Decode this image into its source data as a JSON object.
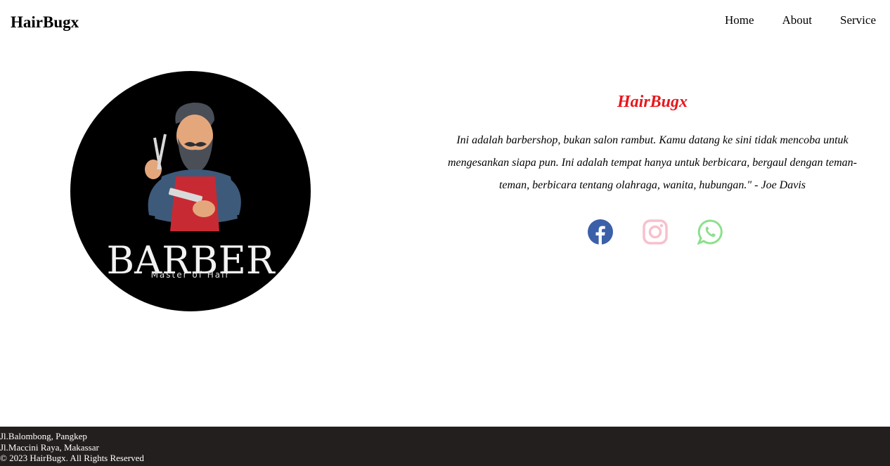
{
  "header": {
    "brand": "HairBugx",
    "nav": [
      {
        "label": "Home"
      },
      {
        "label": "About"
      },
      {
        "label": "Service"
      }
    ]
  },
  "logo": {
    "title": "BARBER",
    "subtitle": "Master of Hair",
    "background": "#000000"
  },
  "about": {
    "title": "HairBugx",
    "text": "Ini adalah barbershop, bukan salon rambut. Kamu datang ke sini tidak mencoba untuk mengesankan siapa pun. Ini adalah tempat hanya untuk berbicara, bergaul dengan teman-teman, berbicara tentang olahraga, wanita, hubungan.\" - Joe Davis",
    "title_color": "#e8161b"
  },
  "social": [
    {
      "icon": "facebook-icon",
      "color": "#3b5fa8"
    },
    {
      "icon": "instagram-icon",
      "color": "#f7c0cd"
    },
    {
      "icon": "whatsapp-icon",
      "color": "#8be08b"
    }
  ],
  "footer": {
    "address1": "Jl.Balombong, Pangkep",
    "address2": "Jl.Maccini Raya, Makassar",
    "copyright": "© 2023 HairBugx. All Rights Reserved",
    "background": "#231f1e"
  }
}
